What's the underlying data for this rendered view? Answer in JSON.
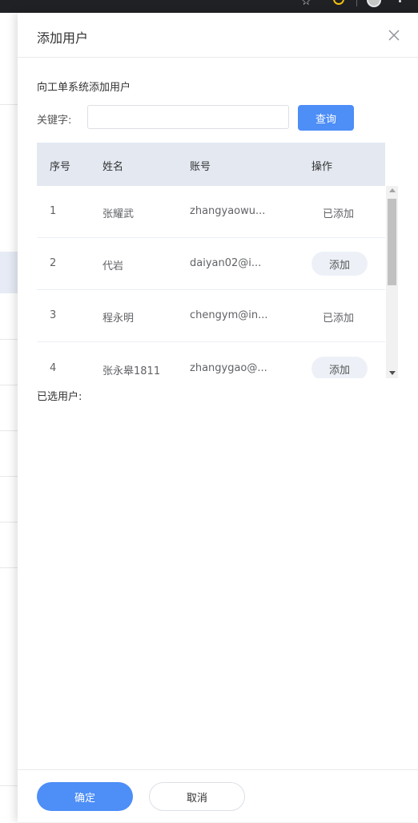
{
  "drawer": {
    "title": "添加用户",
    "subtitle": "向工单系统添加用户"
  },
  "search": {
    "label": "关键字:",
    "value": "",
    "placeholder": "",
    "button_label": "查询"
  },
  "table": {
    "headers": [
      "序号",
      "姓名",
      "账号",
      "操作"
    ],
    "rows": [
      {
        "index": "1",
        "name": "张耀武",
        "account": "zhangyaowu...",
        "action": "已添加",
        "action_type": "status"
      },
      {
        "index": "2",
        "name": "代岩",
        "account": "daiyan02@i...",
        "action": "添加",
        "action_type": "button"
      },
      {
        "index": "3",
        "name": "程永明",
        "account": "chengym@in...",
        "action": "已添加",
        "action_type": "status"
      },
      {
        "index": "4",
        "name": "张永皋1811",
        "account": "zhangygao@...",
        "action": "添加",
        "action_type": "button"
      }
    ]
  },
  "selected": {
    "label": "已选用户:"
  },
  "footer": {
    "confirm_label": "确定",
    "cancel_label": "取消"
  },
  "colors": {
    "accent": "#4d8ef7",
    "header_bg": "#e3e8f1",
    "pill_bg": "#edf1f7"
  }
}
